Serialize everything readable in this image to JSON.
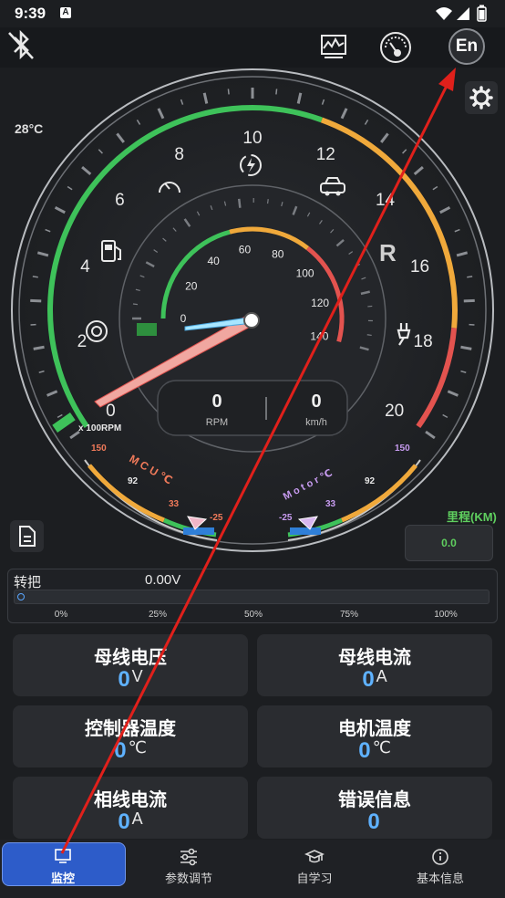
{
  "status": {
    "time": "9:39",
    "notif_letter": "A"
  },
  "header": {
    "lang_button": "En"
  },
  "temperature": "28°C",
  "gauge": {
    "rpm_ticks": [
      "0",
      "2",
      "4",
      "6",
      "8",
      "10",
      "12",
      "14",
      "16",
      "18",
      "20"
    ],
    "rpm_unit": "x 100RPM",
    "speed_ticks": [
      "0",
      "20",
      "40",
      "60",
      "80",
      "100",
      "120",
      "140"
    ],
    "gear": "R",
    "rpm_value": "0",
    "rpm_label": "RPM",
    "speed_value": "0",
    "speed_label": "km/h",
    "mcu_label": "M C U ℃",
    "mcu_ticks": [
      "150",
      "92",
      "33",
      "-25"
    ],
    "motor_label": "M o t o r ℃",
    "motor_ticks": [
      "150",
      "92",
      "33",
      "-25"
    ],
    "colors": {
      "green": "#3ec25a",
      "orange": "#f0a93b",
      "red": "#e3534f",
      "blue": "#2f7fd8"
    }
  },
  "mileage": {
    "label": "里程(KM)",
    "value": "0.0"
  },
  "throttle": {
    "label": "转把",
    "value": "0.00V",
    "level_percent": 0,
    "ticks": [
      "0%",
      "25%",
      "50%",
      "75%",
      "100%"
    ]
  },
  "cards": [
    {
      "title": "母线电压",
      "value": "0",
      "unit": "V"
    },
    {
      "title": "母线电流",
      "value": "0",
      "unit": "A"
    },
    {
      "title": "控制器温度",
      "value": "0",
      "unit": "℃"
    },
    {
      "title": "电机温度",
      "value": "0",
      "unit": "℃"
    },
    {
      "title": "相线电流",
      "value": "0",
      "unit": "A"
    },
    {
      "title": "错误信息",
      "value": "0",
      "unit": ""
    }
  ],
  "nav": [
    {
      "label": "监控",
      "icon": "monitor-icon"
    },
    {
      "label": "参数调节",
      "icon": "sliders-icon"
    },
    {
      "label": "自学习",
      "icon": "graduation-cap-icon"
    },
    {
      "label": "基本信息",
      "icon": "info-icon"
    }
  ]
}
